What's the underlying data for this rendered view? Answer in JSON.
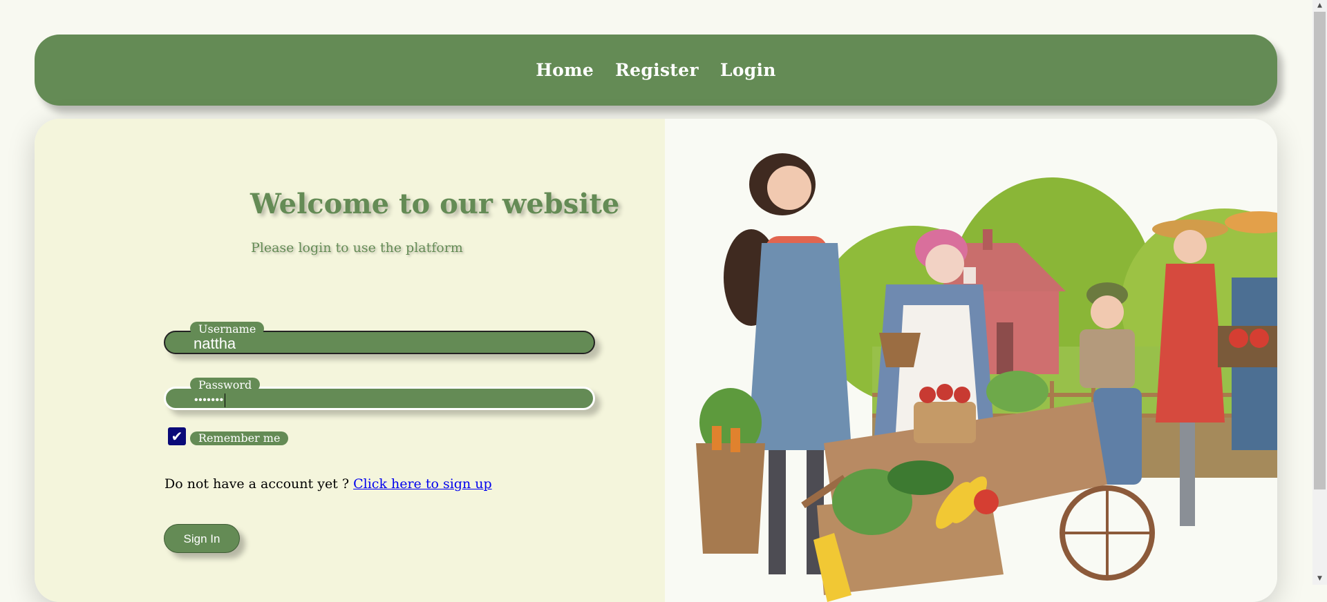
{
  "nav": {
    "items": [
      {
        "label": "Home"
      },
      {
        "label": "Register"
      },
      {
        "label": "Login"
      }
    ]
  },
  "login": {
    "title": "Welcome to our website",
    "subtitle": "Please login to use the platform",
    "username": {
      "label": "Username",
      "value": "nattha"
    },
    "password": {
      "label": "Password",
      "masked_value": "•••••••"
    },
    "remember": {
      "label": "Remember me",
      "checked": true
    },
    "signup_prompt": "Do not have a account yet ?",
    "signup_link": "Click here to sign up",
    "signin_label": "Sign In"
  },
  "colors": {
    "primary_green": "#648b55",
    "cream_panel": "#f4f5dc",
    "page_bg": "#f8f9f1",
    "link_blue": "#0000ee",
    "checkbox_blue": "#0a0a78"
  },
  "illustration": {
    "icon": "farmers-market-illustration-icon"
  }
}
